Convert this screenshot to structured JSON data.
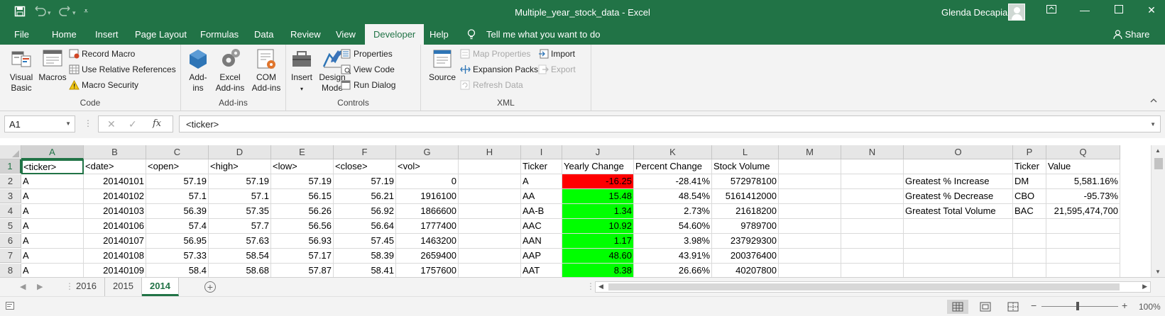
{
  "titlebar": {
    "title": "Multiple_year_stock_data  -  Excel",
    "user": "Glenda Decapia",
    "save_icon": "save-icon",
    "undo_icon": "undo-icon",
    "redo_icon": "redo-icon",
    "customize_icon": "customize-qat-icon"
  },
  "ribbon_tabs": [
    "File",
    "Home",
    "Insert",
    "Page Layout",
    "Formulas",
    "Data",
    "Review",
    "View",
    "Developer",
    "Help"
  ],
  "active_tab": "Developer",
  "tell_me": "Tell me what you want to do",
  "share": "Share",
  "ribbon": {
    "code": {
      "label": "Code",
      "visual_basic": "Visual\nBasic",
      "macros": "Macros",
      "record_macro": "Record Macro",
      "relative_refs": "Use Relative References",
      "macro_security": "Macro Security"
    },
    "addins": {
      "label": "Add-ins",
      "addins": "Add-\nins",
      "excel_addins": "Excel\nAdd-ins",
      "com_addins": "COM\nAdd-ins"
    },
    "controls": {
      "label": "Controls",
      "insert": "Insert",
      "design_mode": "Design\nMode",
      "properties": "Properties",
      "view_code": "View Code",
      "run_dialog": "Run Dialog"
    },
    "xml": {
      "label": "XML",
      "source": "Source",
      "map_properties": "Map Properties",
      "expansion_packs": "Expansion Packs",
      "refresh_data": "Refresh Data",
      "import": "Import",
      "export": "Export"
    }
  },
  "formula_bar": {
    "name_box": "A1",
    "formula": "<ticker>",
    "fx": "fx"
  },
  "columns": [
    "A",
    "B",
    "C",
    "D",
    "E",
    "F",
    "G",
    "H",
    "I",
    "J",
    "K",
    "L",
    "M",
    "N",
    "O",
    "P",
    "Q"
  ],
  "rows": [
    [
      "<ticker>",
      "<date>",
      "<open>",
      "<high>",
      "<low>",
      "<close>",
      "<vol>",
      "",
      "Ticker",
      "Yearly Change",
      "Percent Change",
      "Stock Volume",
      "",
      "",
      "",
      "Ticker",
      "Value"
    ],
    [
      "A",
      "20140101",
      "57.19",
      "57.19",
      "57.19",
      "57.19",
      "0",
      "",
      "A",
      "-16.25",
      "-28.41%",
      "572978100",
      "",
      "",
      "Greatest % Increase",
      "DM",
      "5,581.16%"
    ],
    [
      "A",
      "20140102",
      "57.1",
      "57.1",
      "56.15",
      "56.21",
      "1916100",
      "",
      "AA",
      "15.48",
      "48.54%",
      "5161412000",
      "",
      "",
      "Greatest % Decrease",
      "CBO",
      "-95.73%"
    ],
    [
      "A",
      "20140103",
      "56.39",
      "57.35",
      "56.26",
      "56.92",
      "1866600",
      "",
      "AA-B",
      "1.34",
      "2.73%",
      "21618200",
      "",
      "",
      "Greatest Total Volume",
      "BAC",
      "21,595,474,700"
    ],
    [
      "A",
      "20140106",
      "57.4",
      "57.7",
      "56.56",
      "56.64",
      "1777400",
      "",
      "AAC",
      "10.92",
      "54.60%",
      "9789700",
      "",
      "",
      "",
      "",
      ""
    ],
    [
      "A",
      "20140107",
      "56.95",
      "57.63",
      "56.93",
      "57.45",
      "1463200",
      "",
      "AAN",
      "1.17",
      "3.98%",
      "237929300",
      "",
      "",
      "",
      "",
      ""
    ],
    [
      "A",
      "20140108",
      "57.33",
      "58.54",
      "57.17",
      "58.39",
      "2659400",
      "",
      "AAP",
      "48.60",
      "43.91%",
      "200376400",
      "",
      "",
      "",
      "",
      ""
    ],
    [
      "A",
      "20140109",
      "58.4",
      "58.68",
      "57.87",
      "58.41",
      "1757600",
      "",
      "AAT",
      "8.38",
      "26.66%",
      "40207800",
      "",
      "",
      "",
      "",
      ""
    ]
  ],
  "cell_colors": {
    "negative": "#ff0000",
    "positive": "#00ff00"
  },
  "sheets": [
    "2016",
    "2015",
    "2014"
  ],
  "active_sheet": "2014",
  "status": {
    "zoom": "100%"
  },
  "accent": "#217346"
}
